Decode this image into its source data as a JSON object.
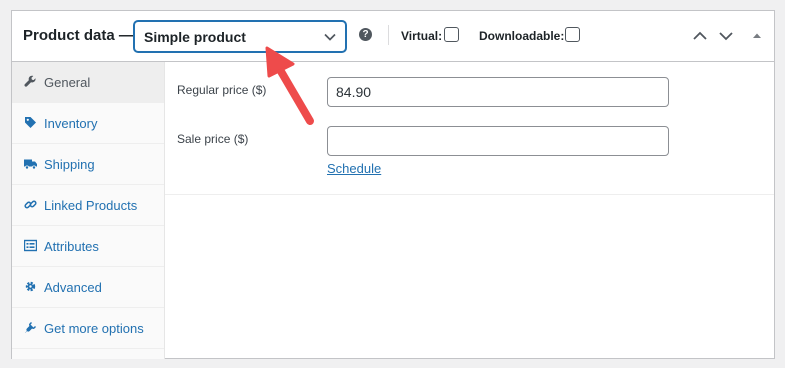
{
  "header": {
    "title": "Product data —",
    "product_type": {
      "selected": "Simple product"
    },
    "help_glyph": "?",
    "virtual_label": "Virtual:",
    "virtual_checked": false,
    "downloadable_label": "Downloadable:",
    "downloadable_checked": false
  },
  "tabs": [
    {
      "label": "General",
      "icon": "wrench-icon",
      "active": true
    },
    {
      "label": "Inventory",
      "icon": "tag-icon"
    },
    {
      "label": "Shipping",
      "icon": "truck-icon"
    },
    {
      "label": "Linked Products",
      "icon": "link-icon"
    },
    {
      "label": "Attributes",
      "icon": "list-icon"
    },
    {
      "label": "Advanced",
      "icon": "gear-icon"
    },
    {
      "label": "Get more options",
      "icon": "plug-icon"
    }
  ],
  "general": {
    "regular_price_label": "Regular price ($)",
    "regular_price_value": "84.90",
    "sale_price_label": "Sale price ($)",
    "sale_price_value": "",
    "schedule_link": "Schedule"
  },
  "colors": {
    "accent": "#2271b1",
    "annotation_arrow": "#ee4b4b"
  }
}
